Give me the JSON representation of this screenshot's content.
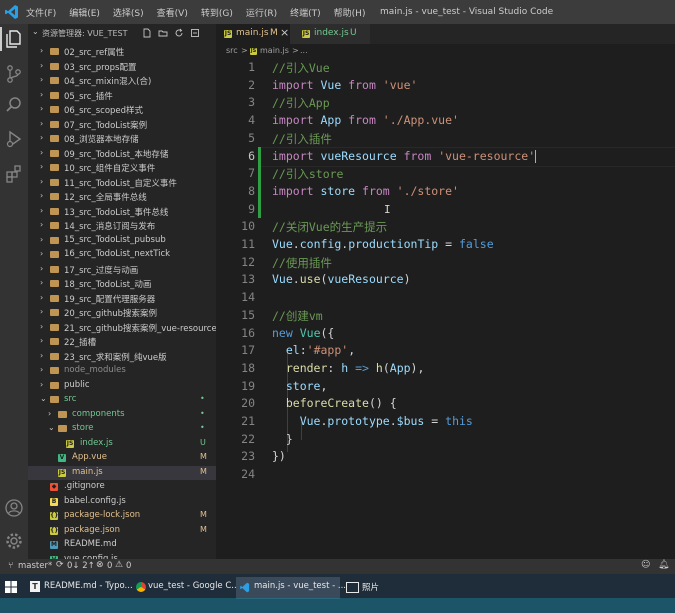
{
  "menu": [
    "文件(F)",
    "编辑(E)",
    "选择(S)",
    "查看(V)",
    "转到(G)",
    "运行(R)",
    "终端(T)",
    "帮助(H)"
  ],
  "window_title": "main.js - vue_test - Visual Studio Code",
  "sidebar": {
    "title": "资源管理器: VUE_TEST",
    "items": [
      {
        "label": "02_src_ref属性",
        "type": "folder"
      },
      {
        "label": "03_src_props配置",
        "type": "folder"
      },
      {
        "label": "04_src_mixin混入(合)",
        "type": "folder"
      },
      {
        "label": "05_src_插件",
        "type": "folder"
      },
      {
        "label": "06_src_scoped样式",
        "type": "folder"
      },
      {
        "label": "07_src_TodoList案例",
        "type": "folder"
      },
      {
        "label": "08_浏览器本地存储",
        "type": "folder"
      },
      {
        "label": "09_src_TodoList_本地存储",
        "type": "folder"
      },
      {
        "label": "10_src_组件自定义事件",
        "type": "folder"
      },
      {
        "label": "11_src_TodoList_自定义事件",
        "type": "folder"
      },
      {
        "label": "12_src_全局事件总线",
        "type": "folder"
      },
      {
        "label": "13_src_TodoList_事件总线",
        "type": "folder"
      },
      {
        "label": "14_src_消息订阅与发布",
        "type": "folder"
      },
      {
        "label": "15_src_TodoList_pubsub",
        "type": "folder"
      },
      {
        "label": "16_src_TodoList_nextTick",
        "type": "folder"
      },
      {
        "label": "17_src_过度与动画",
        "type": "folder"
      },
      {
        "label": "18_src_TodoList_动画",
        "type": "folder"
      },
      {
        "label": "19_src_配置代理服务器",
        "type": "folder"
      },
      {
        "label": "20_src_github搜索案例",
        "type": "folder"
      },
      {
        "label": "21_src_github搜索案例_vue-resource",
        "type": "folder"
      },
      {
        "label": "22_插槽",
        "type": "folder"
      },
      {
        "label": "23_src_求和案例_纯vue版",
        "type": "folder"
      },
      {
        "label": "node_modules",
        "type": "folder"
      },
      {
        "label": "public",
        "type": "folder"
      },
      {
        "label": "src",
        "type": "folder-open",
        "badge": "•"
      },
      {
        "label": "components",
        "type": "folder",
        "badge": "•"
      },
      {
        "label": "store",
        "type": "folder-open",
        "badge": "•"
      },
      {
        "label": "index.js",
        "type": "js",
        "badge": "U"
      },
      {
        "label": "App.vue",
        "type": "vue",
        "badge": "M"
      },
      {
        "label": "main.js",
        "type": "js",
        "badge": "M"
      },
      {
        "label": ".gitignore",
        "type": "git"
      },
      {
        "label": "babel.config.js",
        "type": "babel"
      },
      {
        "label": "package-lock.json",
        "type": "json",
        "badge": "M"
      },
      {
        "label": "package.json",
        "type": "json",
        "badge": "M"
      },
      {
        "label": "README.md",
        "type": "md"
      },
      {
        "label": "vue.config.js",
        "type": "vue"
      }
    ]
  },
  "tabs": [
    {
      "label": "main.js",
      "badge": "M",
      "close": "×"
    },
    {
      "label": "index.js",
      "badge": "U"
    }
  ],
  "breadcrumb": {
    "folder": "src",
    "sep": ">",
    "file": "main.js",
    "sep2": ">",
    "more": "..."
  },
  "line_numbers": [
    "1",
    "2",
    "3",
    "4",
    "5",
    "6",
    "7",
    "8",
    "9",
    "10",
    "11",
    "12",
    "13",
    "14",
    "15",
    "16",
    "17",
    "18",
    "19",
    "20",
    "21",
    "22",
    "23",
    "24"
  ],
  "code": {
    "l1": "//引入Vue",
    "l2a": "import",
    "l2b": " Vue ",
    "l2c": "from",
    "l2d": " 'vue'",
    "l3": "//引入App",
    "l4a": "import",
    "l4b": " App ",
    "l4c": "from",
    "l4d": " './App.vue'",
    "l5": "//引入插件",
    "l6a": "import",
    "l6b": " vueResource ",
    "l6c": "from",
    "l6d": " 'vue-resource'",
    "l7": "//引入store",
    "l8a": "import",
    "l8b": " store ",
    "l8c": "from",
    "l8d": " './store'",
    "l10": "//关闭Vue的生产提示",
    "l11a": "Vue",
    "l11b": ".",
    "l11c": "config",
    "l11d": ".",
    "l11e": "productionTip",
    "l11f": " = ",
    "l11g": "false",
    "l12": "//使用插件",
    "l13a": "Vue",
    "l13b": ".",
    "l13c": "use",
    "l13d": "(",
    "l13e": "vueResource",
    "l13f": ")",
    "l15": "//创建vm",
    "l16a": "new",
    "l16b": " ",
    "l16c": "Vue",
    "l16d": "({",
    "l17a": "  el",
    "l17b": ":",
    "l17c": "'#app'",
    "l17d": ",",
    "l18a": "  render",
    "l18b": ": ",
    "l18c": "h",
    "l18d": " => ",
    "l18e": "h",
    "l18f": "(",
    "l18g": "App",
    "l18h": "),",
    "l19a": "  store",
    "l19b": ",",
    "l20a": "  beforeCreate",
    "l20b": "() {",
    "l21a": "    Vue",
    "l21b": ".",
    "l21c": "prototype",
    "l21d": ".",
    "l21e": "$bus",
    "l21f": " = ",
    "l21g": "this",
    "l22": "  }",
    "l23": "})"
  },
  "status": {
    "branch": "master*",
    "sync": "0↓ 2↑",
    "errors": "0",
    "warnings": "0"
  },
  "taskbar": [
    {
      "label": "README.md - Typo..."
    },
    {
      "label": "vue_test - Google C..."
    },
    {
      "label": "main.js - vue_test - ..."
    },
    {
      "label": "照片"
    }
  ],
  "colors": {
    "accent": "#007acc",
    "git_modified": "#e2c08d",
    "git_untracked": "#73c991",
    "comment": "#6a9955",
    "keyword": "#c586c0"
  }
}
